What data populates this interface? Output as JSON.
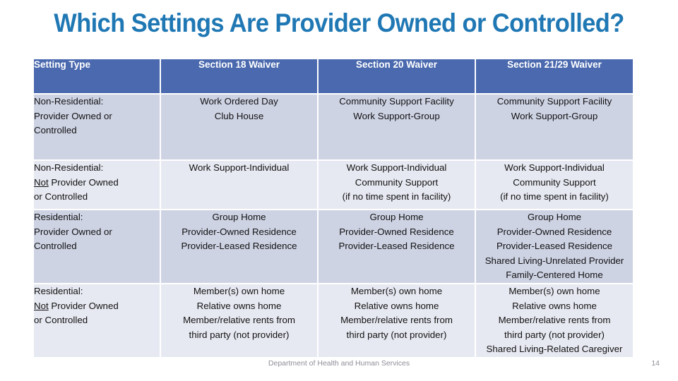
{
  "slide": {
    "title": "Which Settings Are Provider Owned or Controlled?",
    "title_color": "#1F78B4"
  },
  "table": {
    "header_bg": "#4A69AE",
    "header_text_color": "#FFFFFF",
    "band_dark": "#CED3E4",
    "band_light": "#E7E9F2",
    "columns": [
      "Setting Type",
      "Section 18 Waiver",
      "Section 20 Waiver",
      "Section 21/29 Waiver"
    ],
    "rows": [
      {
        "label_lines": [
          "Non-Residential:",
          "Provider Owned or",
          "Controlled"
        ],
        "label_underline": "",
        "section18": [
          "Work Ordered Day",
          "Club House"
        ],
        "section20": [
          "Community Support Facility",
          "Work Support-Group"
        ],
        "section2129": [
          "Community Support Facility",
          "Work Support-Group"
        ]
      },
      {
        "label_lines": [
          "Non-Residential:",
          "Provider Owned",
          "or Controlled"
        ],
        "label_underline": "Not",
        "section18": [
          "Work Support-Individual"
        ],
        "section20": [
          "Work Support-Individual",
          "Community Support",
          "(if no time spent in facility)"
        ],
        "section2129": [
          "Work Support-Individual",
          "Community Support",
          "(if no time spent in facility)"
        ]
      },
      {
        "label_lines": [
          "Residential:",
          "Provider Owned or",
          "Controlled"
        ],
        "label_underline": "",
        "section18": [
          "Group Home",
          "Provider-Owned Residence",
          "Provider-Leased Residence"
        ],
        "section20": [
          "Group Home",
          "Provider-Owned Residence",
          "Provider-Leased Residence"
        ],
        "section2129": [
          "Group Home",
          "Provider-Owned Residence",
          "Provider-Leased Residence",
          "Shared Living-Unrelated Provider",
          "Family-Centered Home"
        ]
      },
      {
        "label_lines": [
          "Residential:",
          "Provider Owned",
          "or Controlled"
        ],
        "label_underline": "Not",
        "section18": [
          "Member(s) own home",
          "Relative owns home",
          "Member/relative rents from",
          "third party (not provider)"
        ],
        "section20": [
          "Member(s) own home",
          "Relative owns home",
          "Member/relative rents from",
          "third party (not provider)"
        ],
        "section2129": [
          "Member(s) own home",
          "Relative owns home",
          "Member/relative rents from",
          "third party (not provider)",
          "Shared Living-Related Caregiver"
        ]
      }
    ]
  },
  "footer": {
    "organization": "Department of Health and Human Services",
    "page_number": "14"
  }
}
